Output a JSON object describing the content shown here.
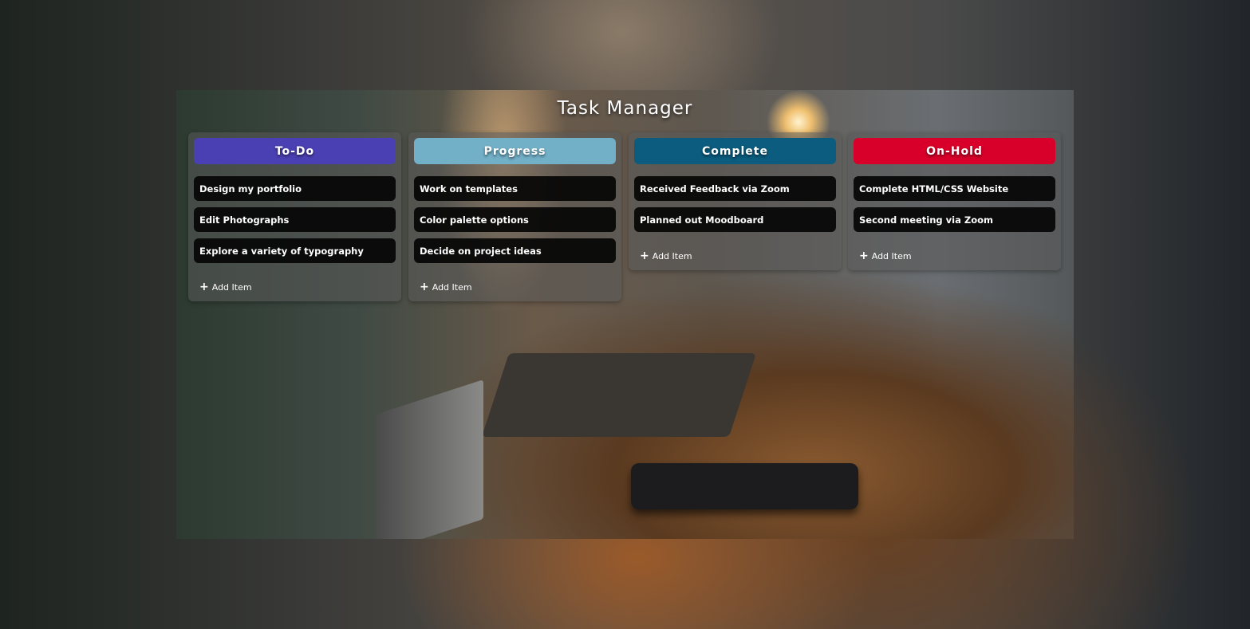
{
  "app": {
    "title": "Task Manager"
  },
  "columns": [
    {
      "name": "To-Do",
      "color": "#4b40b3",
      "items": [
        "Design my portfolio",
        "Edit Photographs",
        "Explore a variety of typography"
      ],
      "add_label": "Add Item"
    },
    {
      "name": "Progress",
      "color": "#72b0c8",
      "items": [
        "Work on templates",
        "Color palette options",
        "Decide on project ideas"
      ],
      "add_label": "Add Item"
    },
    {
      "name": "Complete",
      "color": "#0b5c7e",
      "items": [
        "Received Feedback via Zoom",
        "Planned out Moodboard"
      ],
      "add_label": "Add Item"
    },
    {
      "name": "On-Hold",
      "color": "#d8002a",
      "items": [
        "Complete HTML/CSS Website",
        "Second meeting via Zoom"
      ],
      "add_label": "Add Item"
    }
  ]
}
